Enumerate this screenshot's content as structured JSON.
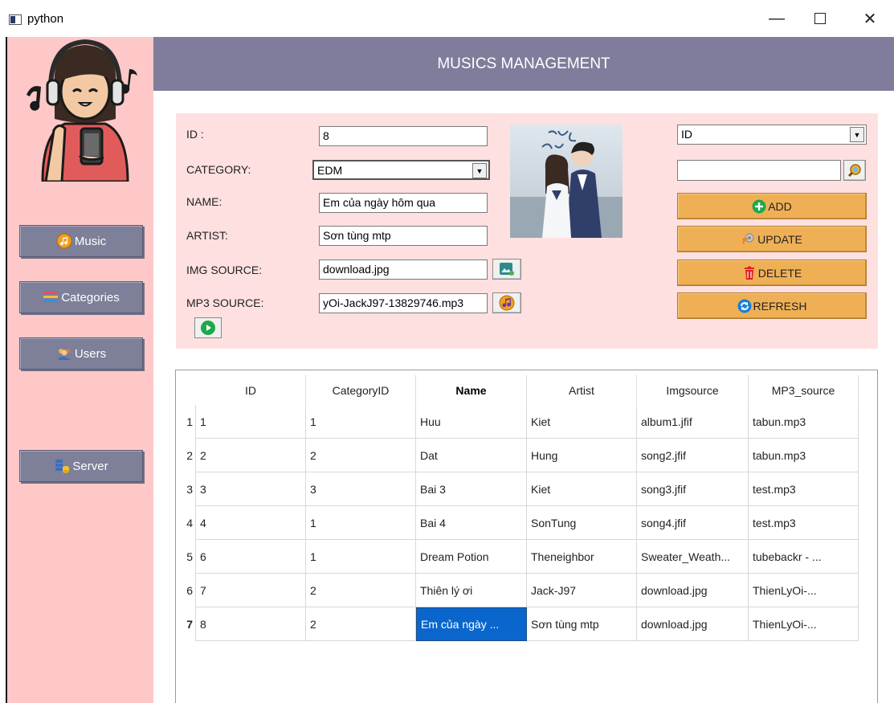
{
  "window": {
    "title": "python",
    "minimize_glyph": "—",
    "close_glyph": "✕"
  },
  "sidebar": {
    "buttons": [
      {
        "label": "Music",
        "icon": "music-disc-icon"
      },
      {
        "label": "Categories",
        "icon": "categories-list-icon"
      },
      {
        "label": "Users",
        "icon": "users-group-icon"
      },
      {
        "label": "Server",
        "icon": "server-database-icon"
      }
    ]
  },
  "header": {
    "title": "MUSICS MANAGEMENT"
  },
  "form": {
    "labels": {
      "id": "ID :",
      "category": "CATEGORY:",
      "name": "NAME:",
      "artist": "ARTIST:",
      "img_source": "IMG SOURCE:",
      "mp3_source": "MP3 SOURCE:"
    },
    "values": {
      "id": "8",
      "category": "EDM",
      "name": "Em của ngày hôm qua",
      "artist": "Sơn tùng mtp",
      "img_source": "download.jpg",
      "mp3_source": "yOi-JackJ97-13829746.mp3"
    }
  },
  "search": {
    "field_selected": "ID",
    "query": ""
  },
  "actions": {
    "add": "ADD",
    "update": "UPDATE",
    "delete": "DELETE",
    "refresh": "REFRESH"
  },
  "colors": {
    "sidebar_bg": "#ffc8c8",
    "header_bg": "#7f7d9b",
    "form_bg": "#ffe0e0",
    "action_btn": "#efb055",
    "selected_cell": "#0a66cc"
  },
  "table": {
    "columns": [
      "ID",
      "CategoryID",
      "Name",
      "Artist",
      "Imgsource",
      "MP3_source"
    ],
    "row_numbers": [
      "1",
      "2",
      "3",
      "4",
      "5",
      "6",
      "7"
    ],
    "rows": [
      [
        "1",
        "1",
        "Huu",
        "Kiet",
        "album1.jfif",
        "tabun.mp3"
      ],
      [
        "2",
        "2",
        "Dat",
        "Hung",
        "song2.jfif",
        "tabun.mp3"
      ],
      [
        "3",
        "3",
        "Bai 3",
        "Kiet",
        "song3.jfif",
        "test.mp3"
      ],
      [
        "4",
        "1",
        "Bai 4",
        "SonTung",
        "song4.jfif",
        "test.mp3"
      ],
      [
        "6",
        "1",
        "Dream Potion",
        "Theneighbor",
        "Sweater_Weath...",
        "tubebackr - ..."
      ],
      [
        "7",
        "2",
        "Thiên lý ơi",
        "Jack-J97",
        "download.jpg",
        "ThienLyOi-..."
      ],
      [
        "8",
        "2",
        "Em của ngày ...",
        "Sơn tùng mtp",
        "download.jpg",
        "ThienLyOi-..."
      ]
    ]
  }
}
